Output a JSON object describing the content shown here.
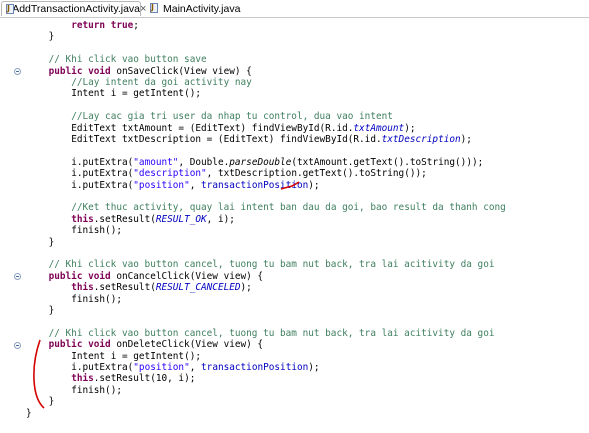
{
  "tabs": [
    {
      "label": "AddTransactionActivity.java",
      "icon": "java-file-icon",
      "active": true
    },
    {
      "label": "MainActivity.java",
      "icon": "java-file-icon",
      "active": false
    }
  ],
  "code_lines": [
    {
      "indent": 8,
      "segments": [
        {
          "t": "return true",
          "c": "kw"
        },
        {
          "t": ";"
        }
      ]
    },
    {
      "indent": 4,
      "segments": [
        {
          "t": "}"
        }
      ]
    },
    {
      "indent": 0,
      "segments": []
    },
    {
      "indent": 4,
      "segments": [
        {
          "t": "// Khi click vao button save",
          "c": "cm"
        }
      ]
    },
    {
      "indent": 4,
      "fold": true,
      "segments": [
        {
          "t": "public void",
          "c": "kw"
        },
        {
          "t": " onSaveClick(View view) {"
        }
      ]
    },
    {
      "indent": 8,
      "segments": [
        {
          "t": "//Lay intent da goi activity nay",
          "c": "cm"
        }
      ]
    },
    {
      "indent": 8,
      "segments": [
        {
          "t": "Intent i = getIntent();"
        }
      ]
    },
    {
      "indent": 0,
      "segments": []
    },
    {
      "indent": 8,
      "segments": [
        {
          "t": "//Lay cac gia tri user da nhap tu control, dua vao intent",
          "c": "cm"
        }
      ]
    },
    {
      "indent": 8,
      "segments": [
        {
          "t": "EditText txtAmount = (EditText) findViewById(R.id."
        },
        {
          "t": "txtAmount",
          "c": "static"
        },
        {
          "t": ");"
        }
      ]
    },
    {
      "indent": 8,
      "segments": [
        {
          "t": "EditText txtDescription = (EditText) findViewById(R.id."
        },
        {
          "t": "txtDescription",
          "c": "static"
        },
        {
          "t": ");"
        }
      ]
    },
    {
      "indent": 0,
      "segments": []
    },
    {
      "indent": 8,
      "segments": [
        {
          "t": "i.putExtra("
        },
        {
          "t": "\"amount\"",
          "c": "str"
        },
        {
          "t": ", Double."
        },
        {
          "t": "parseDouble",
          "c": "sm"
        },
        {
          "t": "(txtAmount.getText().toString()));"
        }
      ]
    },
    {
      "indent": 8,
      "segments": [
        {
          "t": "i.putExtra("
        },
        {
          "t": "\"description\"",
          "c": "str"
        },
        {
          "t": ", txtDescription.getText().toString());"
        }
      ]
    },
    {
      "indent": 8,
      "segments": [
        {
          "t": "i.putExtra("
        },
        {
          "t": "\"position\"",
          "c": "str"
        },
        {
          "t": ", "
        },
        {
          "t": "transactionPosition",
          "c": "fld"
        },
        {
          "t": ");"
        }
      ]
    },
    {
      "indent": 0,
      "segments": []
    },
    {
      "indent": 8,
      "segments": [
        {
          "t": "//Ket thuc activity, quay lai intent ban dau da goi, bao result da thanh cong",
          "c": "cm"
        }
      ]
    },
    {
      "indent": 8,
      "segments": [
        {
          "t": "this",
          "c": "kw"
        },
        {
          "t": ".setResult("
        },
        {
          "t": "RESULT_OK",
          "c": "static"
        },
        {
          "t": ", i);"
        }
      ]
    },
    {
      "indent": 8,
      "segments": [
        {
          "t": "finish();"
        }
      ]
    },
    {
      "indent": 4,
      "segments": [
        {
          "t": "}"
        }
      ]
    },
    {
      "indent": 0,
      "segments": []
    },
    {
      "indent": 4,
      "segments": [
        {
          "t": "// Khi click vao button cancel, tuong tu bam nut back, tra lai acitivity da goi",
          "c": "cm"
        }
      ]
    },
    {
      "indent": 4,
      "fold": true,
      "segments": [
        {
          "t": "public void",
          "c": "kw"
        },
        {
          "t": " onCancelClick(View view) {"
        }
      ]
    },
    {
      "indent": 8,
      "segments": [
        {
          "t": "this",
          "c": "kw"
        },
        {
          "t": ".setResult("
        },
        {
          "t": "RESULT_CANCELED",
          "c": "static"
        },
        {
          "t": ");"
        }
      ]
    },
    {
      "indent": 8,
      "segments": [
        {
          "t": "finish();"
        }
      ]
    },
    {
      "indent": 4,
      "segments": [
        {
          "t": "}"
        }
      ]
    },
    {
      "indent": 0,
      "segments": []
    },
    {
      "indent": 4,
      "segments": [
        {
          "t": "// Khi click vao button cancel, tuong tu bam nut back, tra lai acitivity da goi",
          "c": "cm"
        }
      ]
    },
    {
      "indent": 4,
      "fold": true,
      "segments": [
        {
          "t": "public void",
          "c": "kw"
        },
        {
          "t": " onDeleteClick(View view) {"
        }
      ]
    },
    {
      "indent": 8,
      "segments": [
        {
          "t": "Intent i = getIntent();"
        }
      ]
    },
    {
      "indent": 8,
      "segments": [
        {
          "t": "i.putExtra("
        },
        {
          "t": "\"position\"",
          "c": "str"
        },
        {
          "t": ", "
        },
        {
          "t": "transactionPosition",
          "c": "fld"
        },
        {
          "t": ");"
        }
      ]
    },
    {
      "indent": 8,
      "segments": [
        {
          "t": "this",
          "c": "kw"
        },
        {
          "t": ".setResult(10, i);"
        }
      ]
    },
    {
      "indent": 8,
      "segments": [
        {
          "t": "finish();"
        }
      ]
    },
    {
      "indent": 4,
      "segments": [
        {
          "t": "}"
        }
      ]
    },
    {
      "indent": 0,
      "segments": [
        {
          "t": "}"
        }
      ]
    }
  ],
  "colors": {
    "keyword": "#7f0055",
    "comment": "#3f7f5f",
    "string": "#2a00ff",
    "field": "#0000c0",
    "annotation_marker": "#d40000"
  }
}
